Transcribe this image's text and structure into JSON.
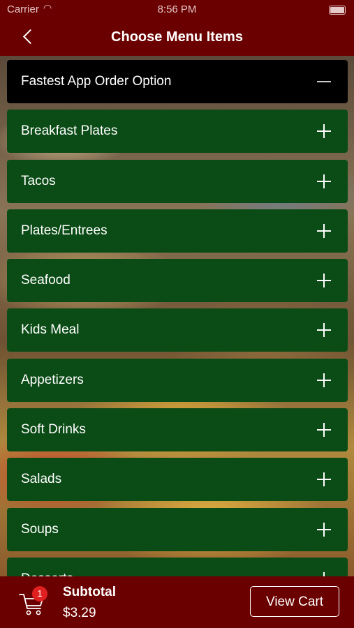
{
  "status_bar": {
    "carrier": "Carrier",
    "time": "8:56 PM"
  },
  "nav": {
    "title": "Choose Menu Items"
  },
  "menu": {
    "expanded": {
      "label": "Fastest App Order Option"
    },
    "categories": [
      {
        "label": "Breakfast Plates"
      },
      {
        "label": "Tacos"
      },
      {
        "label": "Plates/Entrees"
      },
      {
        "label": "Seafood"
      },
      {
        "label": "Kids Meal"
      },
      {
        "label": "Appetizers"
      },
      {
        "label": "Soft Drinks"
      },
      {
        "label": "Salads"
      },
      {
        "label": "Soups"
      },
      {
        "label": "Desserts"
      }
    ]
  },
  "footer": {
    "cart_count": "1",
    "subtotal_label": "Subtotal",
    "subtotal_value": "$3.29",
    "view_cart_label": "View Cart"
  }
}
